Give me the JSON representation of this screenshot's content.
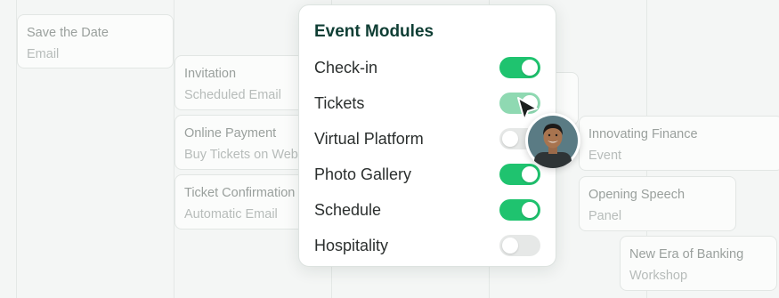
{
  "background_cards": [
    {
      "title": "Save the Date",
      "subtitle": "Email"
    },
    {
      "title": "Invitation",
      "subtitle": "Scheduled Email"
    },
    {
      "title": "Online Payment",
      "subtitle": "Buy Tickets on Website"
    },
    {
      "title": "Ticket Confirmation",
      "subtitle": "Automatic Email"
    },
    {
      "title": "Innovating Finance",
      "subtitle": "Event"
    },
    {
      "title": "Opening Speech",
      "subtitle": "Panel"
    },
    {
      "title": "New Era of Banking",
      "subtitle": "Workshop"
    }
  ],
  "modules_panel": {
    "title": "Event Modules",
    "items": [
      {
        "label": "Check-in",
        "enabled": true
      },
      {
        "label": "Tickets",
        "enabled": true
      },
      {
        "label": "Virtual Platform",
        "enabled": false
      },
      {
        "label": "Photo Gallery",
        "enabled": true
      },
      {
        "label": "Schedule",
        "enabled": true
      },
      {
        "label": "Hospitality",
        "enabled": false
      }
    ]
  },
  "colors": {
    "accent_green": "#1fc36f",
    "title_green": "#0f3e34",
    "toggle_off": "#e6e8e7"
  },
  "icons": {
    "cursor": "pointer-cursor-icon",
    "user": "user-avatar"
  }
}
